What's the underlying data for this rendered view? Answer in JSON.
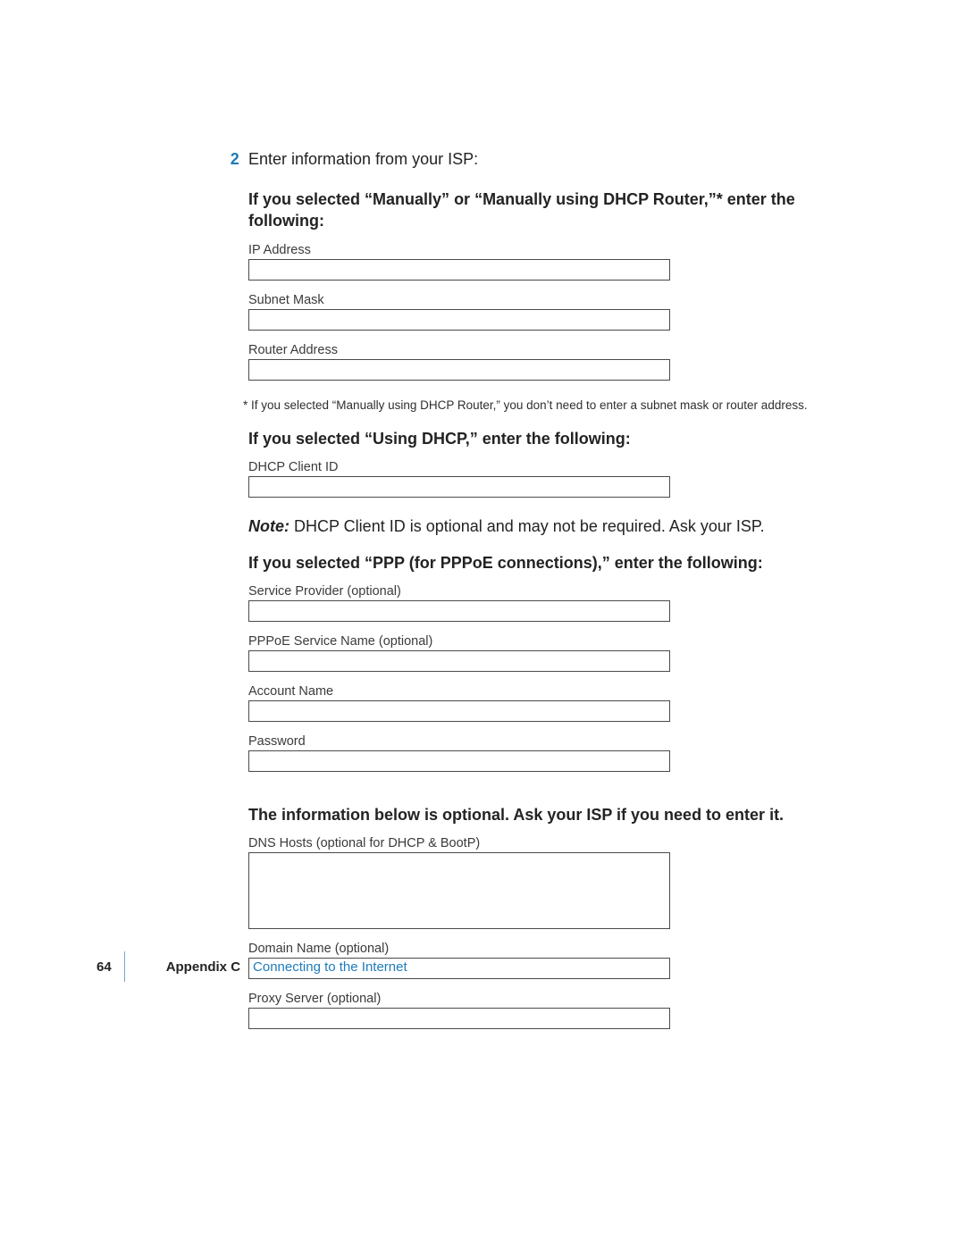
{
  "step": {
    "number": "2",
    "text": "Enter information from your ISP:"
  },
  "section1": {
    "heading": "If you selected “Manually” or “Manually using DHCP Router,”* enter the following:",
    "fields": {
      "ip": "IP Address",
      "subnet": "Subnet Mask",
      "router": "Router Address"
    },
    "footnote": "* If you selected “Manually using DHCP Router,” you don’t need to enter a subnet mask or router address."
  },
  "section2": {
    "heading": "If you selected “Using DHCP,” enter the following:",
    "fields": {
      "dhcp_client_id": "DHCP Client ID"
    }
  },
  "note": {
    "label": "Note:",
    "text": "  DHCP Client ID is optional and may not be required. Ask your ISP."
  },
  "section3": {
    "heading": "If you selected “PPP (for PPPoE connections),” enter the following:",
    "fields": {
      "service_provider": "Service Provider (optional)",
      "pppoe_service": "PPPoE Service Name (optional)",
      "account_name": "Account Name",
      "password": "Password"
    }
  },
  "section4": {
    "heading": "The information below is optional. Ask your ISP if you need to enter it.",
    "fields": {
      "dns_hosts": "DNS Hosts (optional for DHCP & BootP)",
      "domain_name": "Domain Name (optional)",
      "proxy_server": "Proxy Server (optional)"
    }
  },
  "footer": {
    "page_number": "64",
    "appendix": "Appendix C",
    "title": "Connecting to the Internet"
  }
}
